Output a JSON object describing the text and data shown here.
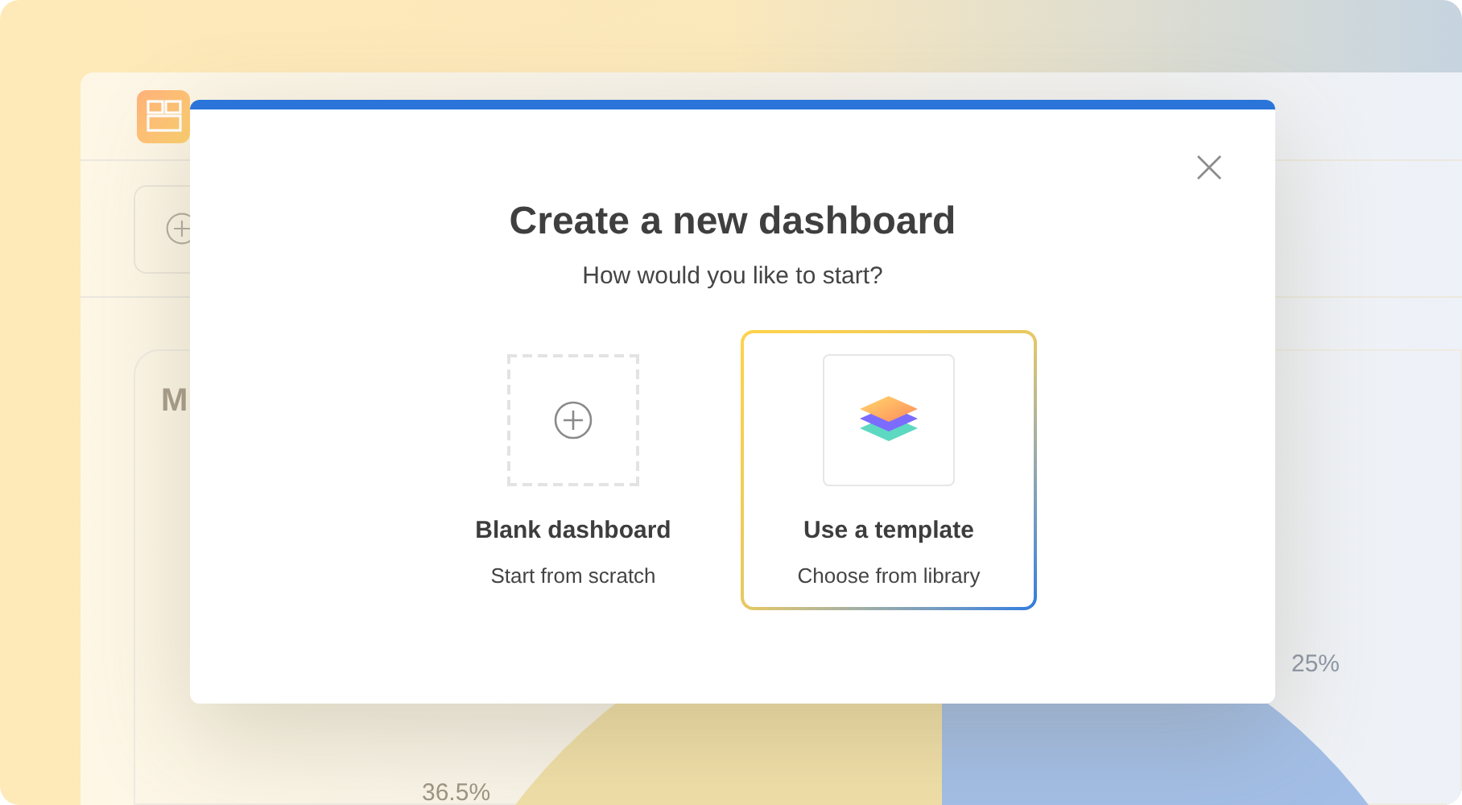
{
  "background_app": {
    "card_title": "M",
    "chart_labels": [
      "36.5%",
      "25%"
    ]
  },
  "dialog": {
    "title": "Create a new dashboard",
    "subtitle": "How would you like to start?",
    "options": [
      {
        "kind": "blank",
        "title": "Blank dashboard",
        "description": "Start from scratch",
        "selected": false
      },
      {
        "kind": "template",
        "title": "Use a template",
        "description": "Choose from library",
        "selected": true
      }
    ]
  }
}
